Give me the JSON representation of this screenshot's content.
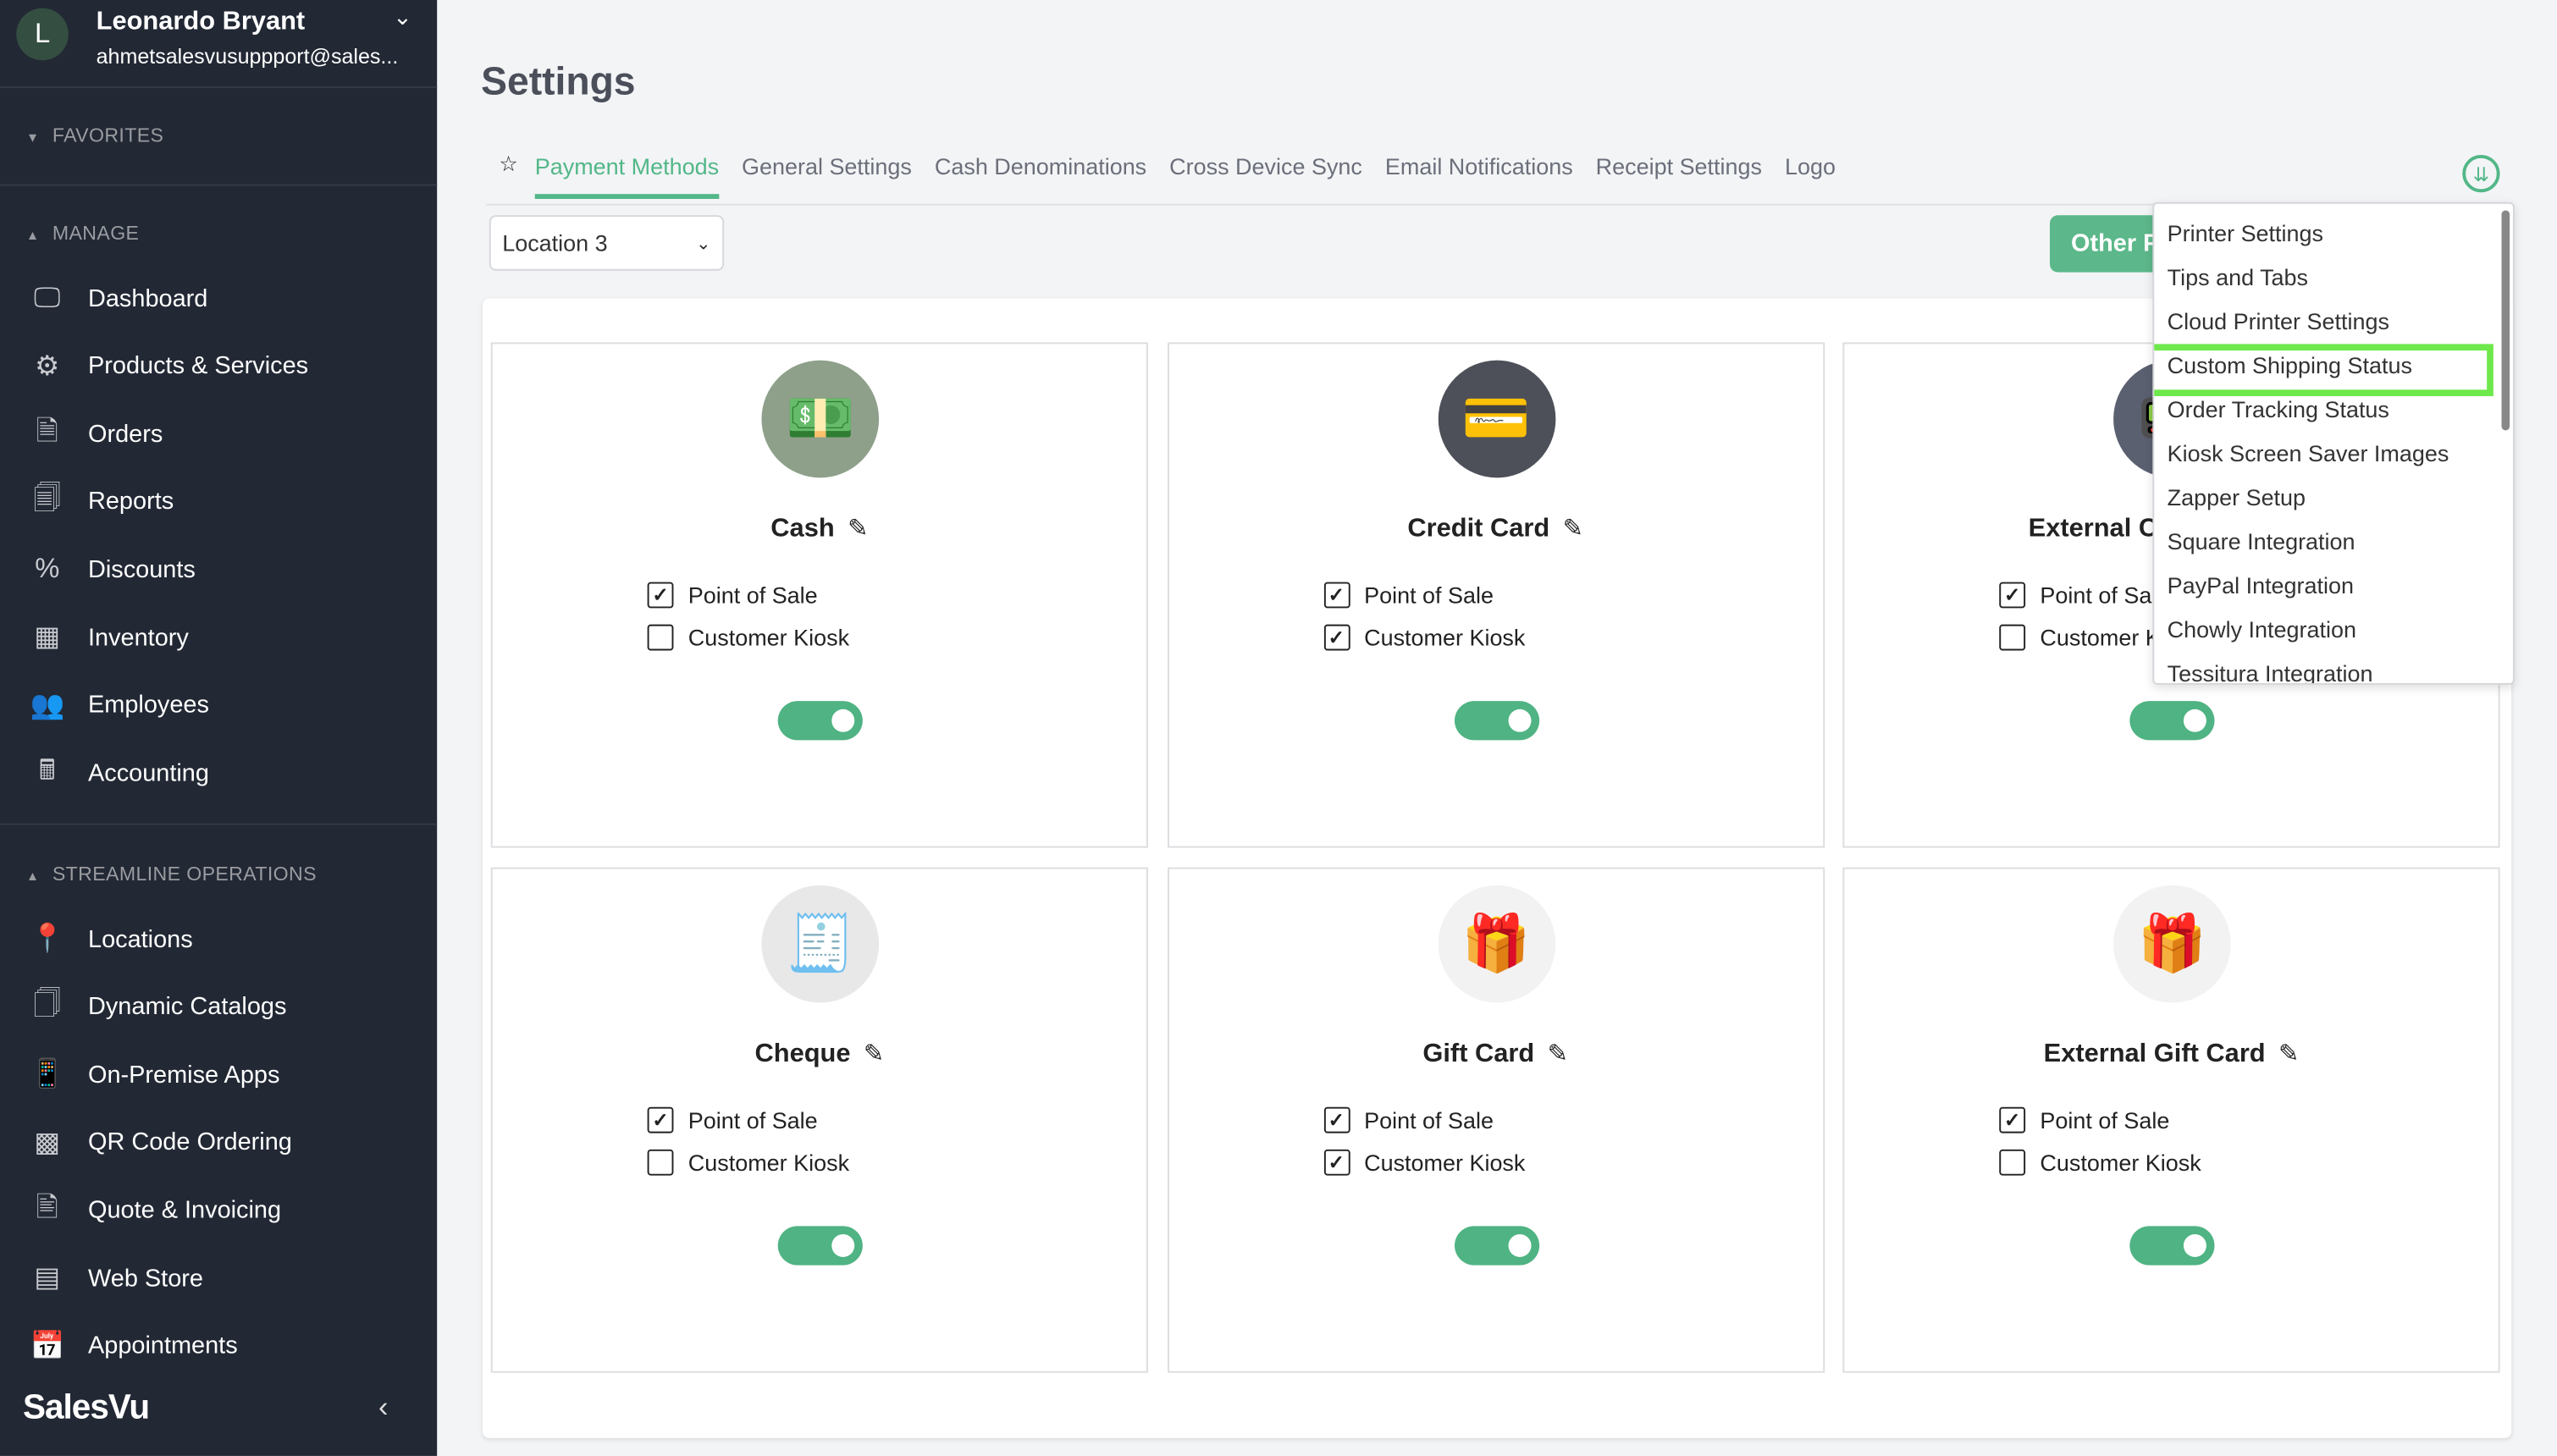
{
  "user": {
    "initial": "L",
    "name": "Leonardo Bryant",
    "email": "ahmetsalesvusuppport@sales..."
  },
  "sidebar": {
    "favorites": "FAVORITES",
    "manage": "MANAGE",
    "streamline": "STREAMLINE OPERATIONS",
    "manage_items": [
      {
        "label": "Dashboard",
        "icon": "monitor-icon"
      },
      {
        "label": "Products & Services",
        "icon": "products-icon"
      },
      {
        "label": "Orders",
        "icon": "orders-icon"
      },
      {
        "label": "Reports",
        "icon": "reports-icon"
      },
      {
        "label": "Discounts",
        "icon": "percent-icon"
      },
      {
        "label": "Inventory",
        "icon": "inventory-icon"
      },
      {
        "label": "Employees",
        "icon": "employees-icon"
      },
      {
        "label": "Accounting",
        "icon": "calculator-icon"
      }
    ],
    "streamline_items": [
      {
        "label": "Locations",
        "icon": "location-pin-icon"
      },
      {
        "label": "Dynamic Catalogs",
        "icon": "catalog-icon"
      },
      {
        "label": "On-Premise Apps",
        "icon": "apps-icon"
      },
      {
        "label": "QR Code Ordering",
        "icon": "qr-code-icon"
      },
      {
        "label": "Quote & Invoicing",
        "icon": "invoice-icon"
      },
      {
        "label": "Web Store",
        "icon": "web-store-icon"
      },
      {
        "label": "Appointments",
        "icon": "calendar-icon"
      }
    ],
    "brand": "SalesVu"
  },
  "page": {
    "title": "Settings"
  },
  "tabs": [
    "Payment Methods",
    "General Settings",
    "Cash Denominations",
    "Cross Device Sync",
    "Email Notifications",
    "Receipt Settings",
    "Logo"
  ],
  "location_select": "Location 3",
  "other_button": "Other Payment Methods",
  "labels": {
    "pos": "Point of Sale",
    "kiosk": "Customer Kiosk"
  },
  "cards": [
    {
      "name": "Cash",
      "pos": true,
      "kiosk": false,
      "enabled": true
    },
    {
      "name": "Credit Card",
      "pos": true,
      "kiosk": true,
      "enabled": true
    },
    {
      "name": "External Credit Card",
      "pos": true,
      "kiosk": false,
      "enabled": true
    },
    {
      "name": "Cheque",
      "pos": true,
      "kiosk": false,
      "enabled": true
    },
    {
      "name": "Gift Card",
      "pos": true,
      "kiosk": true,
      "enabled": true
    },
    {
      "name": "External Gift Card",
      "pos": true,
      "kiosk": false,
      "enabled": true
    }
  ],
  "menu": {
    "items": [
      "Printer Settings",
      "Tips and Tabs",
      "Cloud Printer Settings",
      "Custom Shipping Status",
      "Order Tracking Status",
      "Kiosk Screen Saver Images",
      "Zapper Setup",
      "Square Integration",
      "PayPal Integration",
      "Chowly Integration",
      "Tessitura Integration"
    ],
    "highlighted": "Custom Shipping Status"
  },
  "colors": {
    "accent": "#52b788",
    "sidebar": "#222834",
    "highlight": "#6ee84b"
  }
}
